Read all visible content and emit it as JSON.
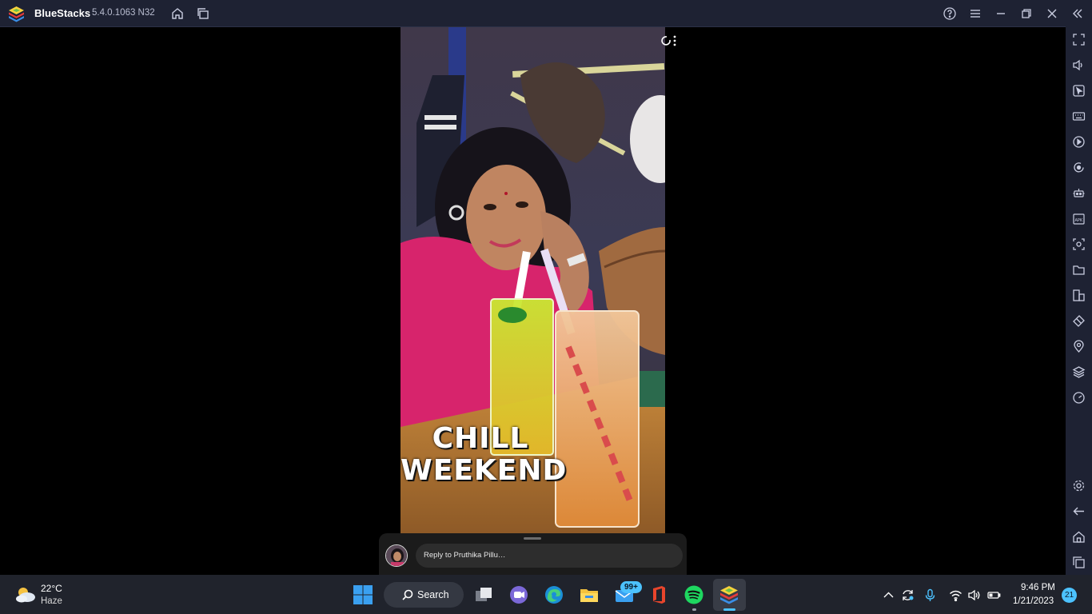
{
  "window": {
    "app_name": "BlueStacks",
    "version": "5.4.0.1063 N32"
  },
  "sidebar": {
    "items": [
      "fullscreen-icon",
      "volume-icon",
      "cursor-icon",
      "keyboard-icon",
      "macro-play-icon",
      "rotate-icon",
      "robot-icon",
      "apk-icon",
      "screenshot-icon",
      "folder-icon",
      "multi-instance-icon",
      "eraser-icon",
      "location-icon",
      "layers-icon",
      "gauge-icon",
      "settings-icon",
      "back-icon",
      "home-icon",
      "recents-icon"
    ]
  },
  "story": {
    "sticker_line1": "CHILL",
    "sticker_line2": "WEEKEND",
    "reply_placeholder": "Reply to Pruthika Pillu…"
  },
  "taskbar": {
    "weather_temp": "22°C",
    "weather_desc": "Haze",
    "search_label": "Search",
    "mail_badge": "99+",
    "time": "9:46 PM",
    "date": "1/21/2023",
    "notification_count": "21"
  },
  "colors": {
    "titlebar_bg": "#1e2233",
    "taskbar_bg": "#20232c",
    "accent": "#4cc2ff"
  }
}
